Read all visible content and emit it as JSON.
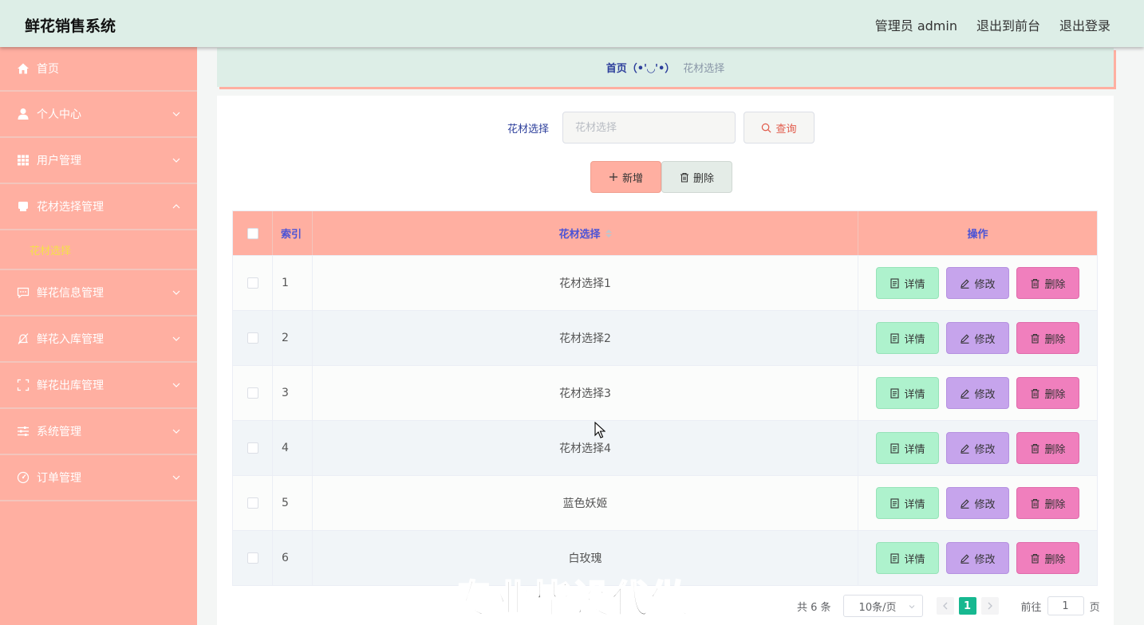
{
  "header": {
    "title": "鲜花销售系统",
    "admin_label": "管理员 admin",
    "front_label": "退出到前台",
    "logout_label": "退出登录"
  },
  "sidebar": {
    "items": [
      {
        "label": "首页",
        "icon": "home-icon"
      },
      {
        "label": "个人中心",
        "icon": "user-icon"
      },
      {
        "label": "用户管理",
        "icon": "grid-icon"
      },
      {
        "label": "花材选择管理",
        "icon": "box-icon",
        "expanded": true
      },
      {
        "label": "鲜花信息管理",
        "icon": "chat-icon"
      },
      {
        "label": "鲜花入库管理",
        "icon": "bell-off-icon"
      },
      {
        "label": "鲜花出库管理",
        "icon": "frame-icon"
      },
      {
        "label": "系统管理",
        "icon": "sliders-icon"
      },
      {
        "label": "订单管理",
        "icon": "gauge-icon"
      }
    ],
    "sub_item": "花材选择"
  },
  "breadcrumb": {
    "home": "首页（•'◡'•）",
    "current": "花材选择"
  },
  "search": {
    "label": "花材选择",
    "placeholder": "花材选择",
    "button": "查询"
  },
  "actions": {
    "add": "新增",
    "delete": "删除"
  },
  "table": {
    "headers": {
      "index": "索引",
      "name": "花材选择",
      "ops": "操作"
    },
    "rows": [
      {
        "index": "1",
        "name": "花材选择1"
      },
      {
        "index": "2",
        "name": "花材选择2"
      },
      {
        "index": "3",
        "name": "花材选择3"
      },
      {
        "index": "4",
        "name": "花材选择4"
      },
      {
        "index": "5",
        "name": "蓝色妖姬"
      },
      {
        "index": "6",
        "name": "白玫瑰"
      }
    ],
    "op_labels": {
      "detail": "详情",
      "edit": "修改",
      "delete": "删除"
    }
  },
  "pagination": {
    "total": "共 6 条",
    "page_size": "10条/页",
    "current_page": "1",
    "goto_prefix": "前往",
    "goto_value": "1",
    "goto_suffix": "页"
  },
  "watermark": "专业毕设代做",
  "colors": {
    "sidebar": "#ffafa1",
    "header": "#ddeee7",
    "detail_btn": "#aef2cd",
    "edit_btn": "#c6a4ec",
    "delete_btn": "#f07fbd",
    "pager_active": "#17b890"
  }
}
